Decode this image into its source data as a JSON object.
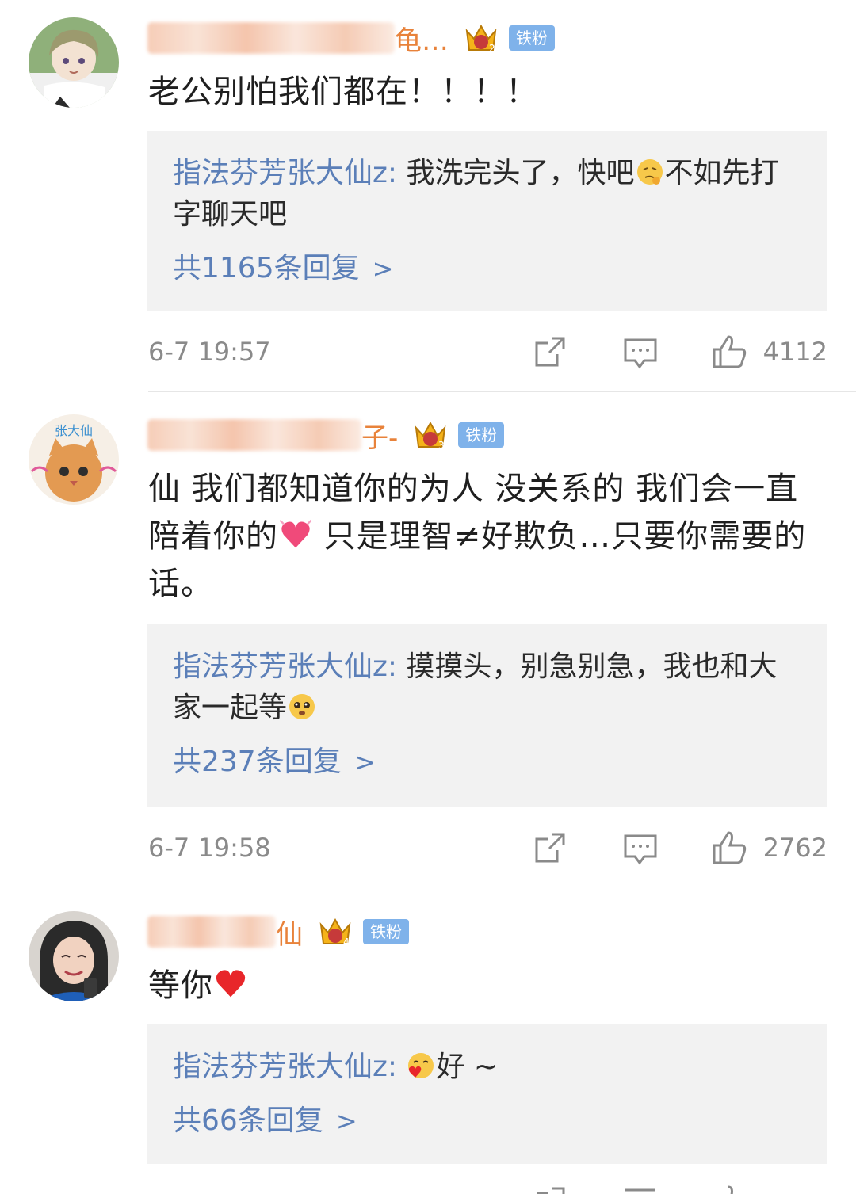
{
  "comments": [
    {
      "username_visible": "龟…",
      "badge": "铁粉",
      "crown_level": "2",
      "text": "老公别怕我们都在！！！！",
      "reply": {
        "author": "指法芬芳张大仙z",
        "sep": ": ",
        "text_before_emoji": "我洗完头了，快吧",
        "emoji": "thinking-emoji",
        "text_after_emoji": "不如先打字聊天吧",
        "count_label": "共1165条回复"
      },
      "timestamp": "6-7 19:57",
      "likes": "4112"
    },
    {
      "username_visible": "子-",
      "badge": "铁粉",
      "crown_level": "3",
      "avatar_caption": "张大仙",
      "text_part1": "仙 我们都知道你的为人 没关系的 我们会一直陪着你的",
      "emoji": "hearts-emoji",
      "text_part2": " 只是理智≠好欺负…只要你需要的话。",
      "reply": {
        "author": "指法芬芳张大仙z",
        "sep": ": ",
        "text_before_emoji": "摸摸头，别急别急，我也和大家一起等",
        "emoji": "pleading-emoji",
        "text_after_emoji": "",
        "count_label": "共237条回复"
      },
      "timestamp": "6-7 19:58",
      "likes": "2762"
    },
    {
      "username_visible": "仙",
      "badge": "铁粉",
      "crown_level": "4",
      "text": "等你",
      "emoji": "red-heart-emoji",
      "reply": {
        "author": "指法芬芳张大仙z",
        "sep": ": ",
        "text_before_emoji": "",
        "emoji": "kiss-emoji",
        "text_after_emoji": "好 ~",
        "count_label": "共66条回复"
      }
    }
  ],
  "ui": {
    "chevron": ">",
    "colors": {
      "username": "#e8823a",
      "reply_author": "#5b7fb8",
      "badge_bg": "#7fb2ea",
      "reply_bg": "#f2f2f2",
      "meta_text": "#8a8a8a"
    }
  }
}
